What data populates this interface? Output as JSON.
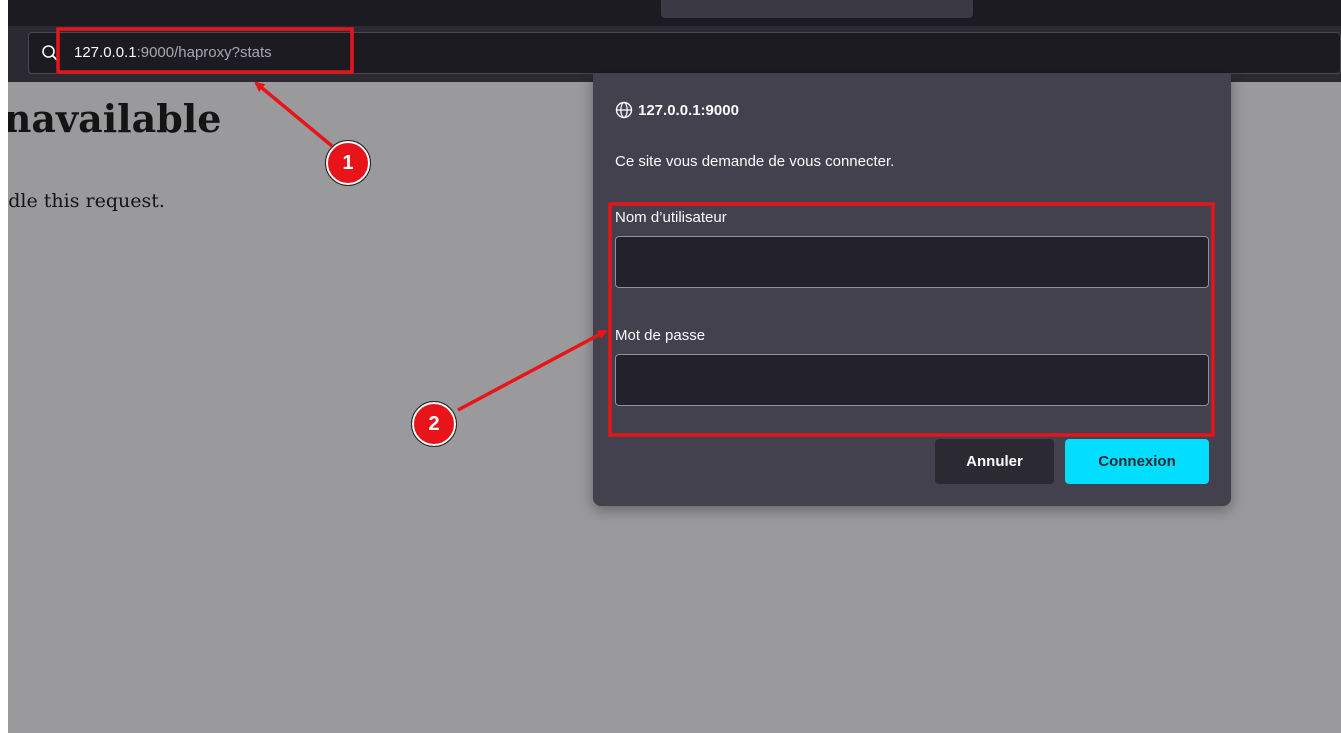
{
  "browser": {
    "url_host": "127.0.0.1",
    "url_rest": ":9000/haproxy?stats",
    "icons": {
      "search": "search-icon"
    }
  },
  "page": {
    "heading_fragment": "Inavailable",
    "text_fragment": "ndle this request."
  },
  "dialog": {
    "host": "127.0.0.1:9000",
    "message": "Ce site vous demande de vous connecter.",
    "username_label": "Nom d’utilisateur",
    "username_value": "",
    "password_label": "Mot de passe",
    "password_value": "",
    "cancel_label": "Annuler",
    "login_label": "Connexion",
    "icons": {
      "host": "globe-icon"
    },
    "colors": {
      "background": "#42414d",
      "login_button": "#00ddff",
      "cancel_button": "#2b2a33"
    }
  },
  "annotations": {
    "callout_1": "1",
    "callout_2": "2",
    "color": "#e8141a"
  }
}
